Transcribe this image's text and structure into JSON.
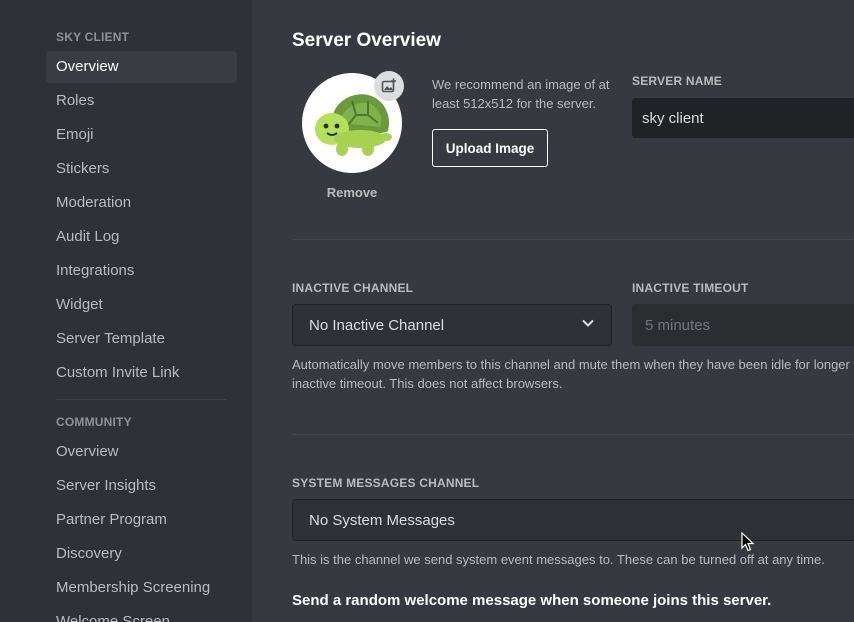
{
  "sidebar": {
    "server_header": "SKY CLIENT",
    "server_items": [
      {
        "label": "Overview"
      },
      {
        "label": "Roles"
      },
      {
        "label": "Emoji"
      },
      {
        "label": "Stickers"
      },
      {
        "label": "Moderation"
      },
      {
        "label": "Audit Log"
      },
      {
        "label": "Integrations"
      },
      {
        "label": "Widget"
      },
      {
        "label": "Server Template"
      },
      {
        "label": "Custom Invite Link"
      }
    ],
    "community_header": "COMMUNITY",
    "community_items": [
      {
        "label": "Overview"
      },
      {
        "label": "Server Insights"
      },
      {
        "label": "Partner Program"
      },
      {
        "label": "Discovery"
      },
      {
        "label": "Membership Screening"
      },
      {
        "label": "Welcome Screen"
      }
    ],
    "selected_item": "Overview"
  },
  "main": {
    "title": "Server Overview",
    "server_icon": {
      "icon": "turtle-avatar",
      "remove_label": "Remove",
      "badge_icon": "add-image-icon"
    },
    "recommend_text": "We recommend an image of at least 512x512 for the server.",
    "upload_button": "Upload Image",
    "server_name": {
      "label": "SERVER NAME",
      "value": "sky client"
    },
    "inactive_channel": {
      "label": "INACTIVE CHANNEL",
      "value": "No Inactive Channel"
    },
    "inactive_timeout": {
      "label": "INACTIVE TIMEOUT",
      "value": "5 minutes"
    },
    "inactive_help": {
      "line1": "Automatically move members to this channel and mute them when they have been idle for longer than the",
      "line2": "inactive timeout. This does not affect browsers."
    },
    "system_messages": {
      "label": "SYSTEM MESSAGES CHANNEL",
      "value": "No System Messages",
      "help": "This is the channel we send system event messages to. These can be turned off at any time."
    },
    "welcome_message_toggle_label": "Send a random welcome message when someone joins this server."
  },
  "colors": {
    "sidebar_bg": "#2f3136",
    "content_bg": "#36393f",
    "input_bg": "#202225",
    "selected_bg": "#393c43",
    "text_primary": "#ffffff",
    "text_muted": "#b9bbbe",
    "header_muted": "#8e9297"
  }
}
